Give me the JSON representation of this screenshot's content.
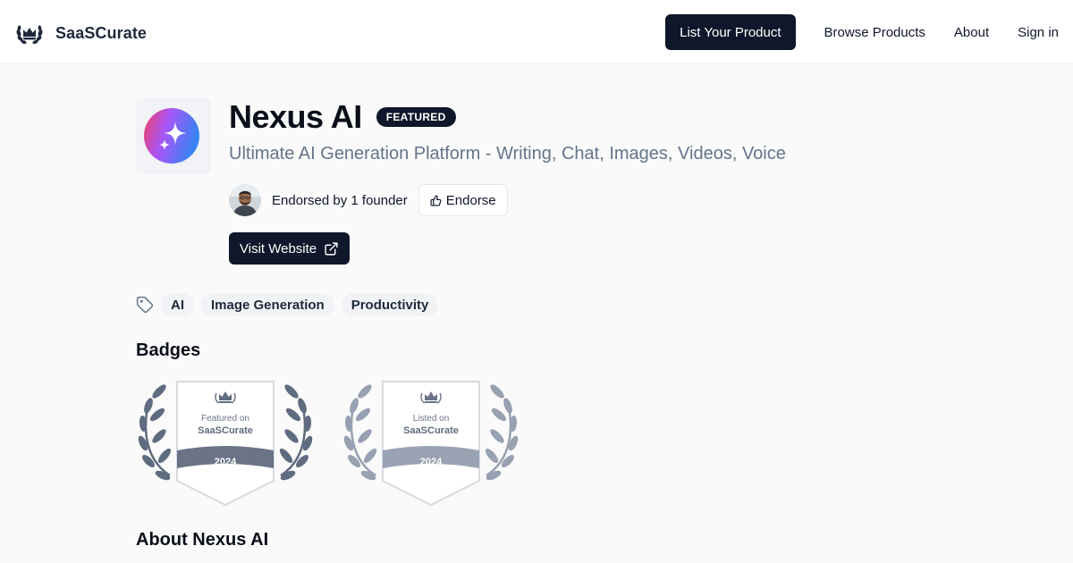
{
  "header": {
    "brand_name": "SaaSCurate",
    "cta_label": "List Your Product",
    "nav": [
      {
        "label": "Browse Products"
      },
      {
        "label": "About"
      },
      {
        "label": "Sign in"
      }
    ]
  },
  "product": {
    "name": "Nexus AI",
    "featured_label": "FEATURED",
    "tagline": "Ultimate AI Generation Platform - Writing, Chat, Images, Videos, Voice",
    "endorsement_text": "Endorsed by 1 founder",
    "endorse_label": "Endorse",
    "visit_label": "Visit Website",
    "tags": [
      "AI",
      "Image Generation",
      "Productivity"
    ]
  },
  "badges_section": {
    "heading": "Badges",
    "items": [
      {
        "line1": "Featured on",
        "brand": "SaaSCurate",
        "year": "2024",
        "ribbon_color": "#6b7486"
      },
      {
        "line1": "Listed on",
        "brand": "SaaSCurate",
        "year": "2024",
        "ribbon_color": "#9aa3b3"
      }
    ]
  },
  "about_section": {
    "heading": "About Nexus AI"
  },
  "colors": {
    "primary": "#0f172a",
    "muted_text": "#64748b",
    "badge_laurel_dark": "#5f6b7e",
    "badge_laurel_light": "#97a1b2"
  },
  "icons": {
    "brand": "crown-laurel-icon",
    "product": "sparkle-icon",
    "endorse": "thumbs-up-icon",
    "visit": "external-link-icon",
    "tags": "tag-icon"
  }
}
